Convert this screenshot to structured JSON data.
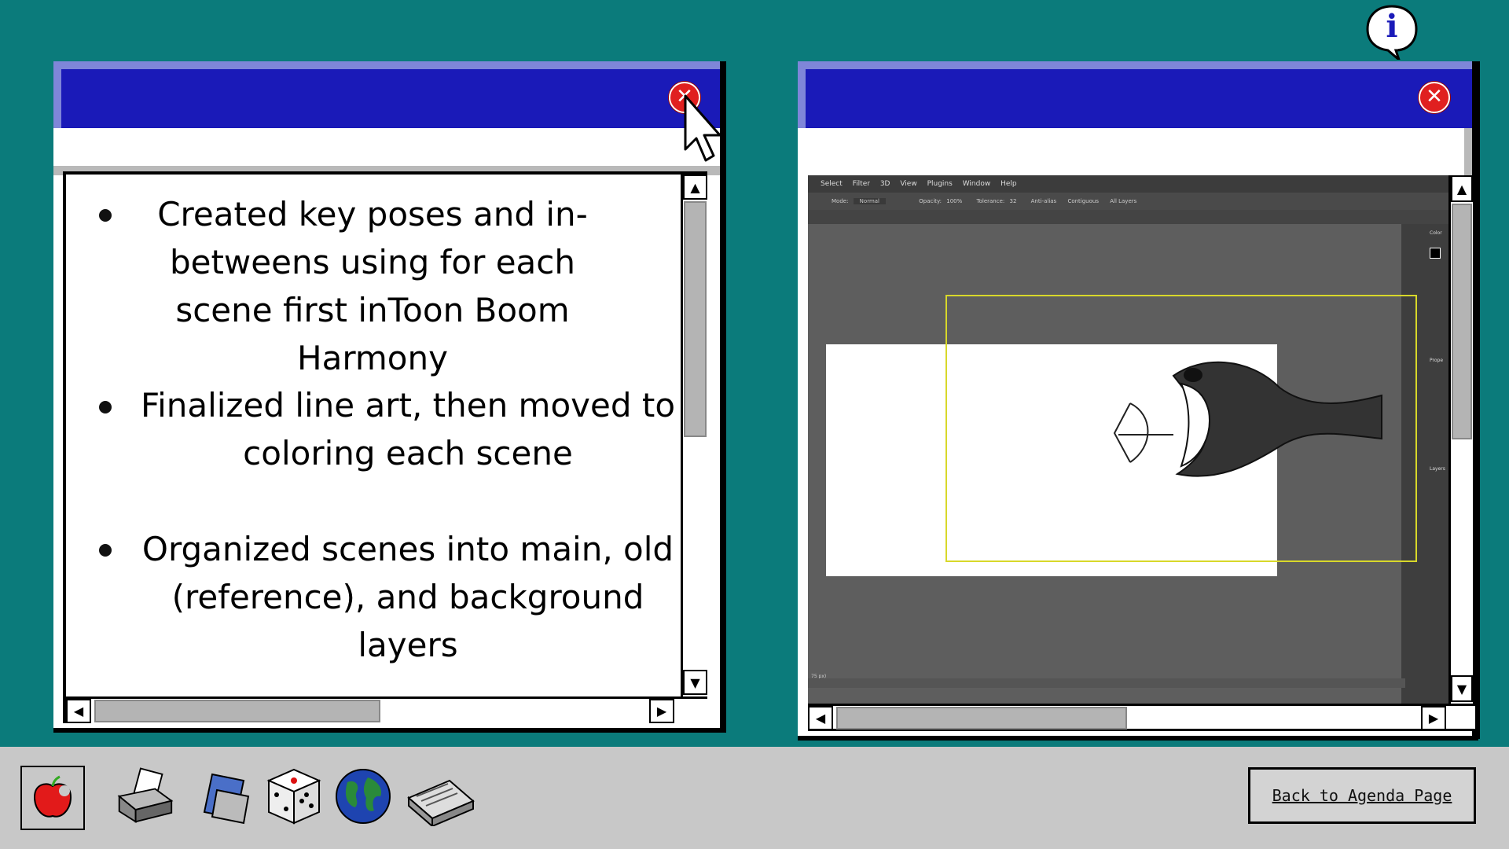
{
  "left_window": {
    "bullets": [
      "Created key poses and in-betweens using for each scene first inToon Boom Harmony",
      "Finalized line art, then moved to coloring each scene",
      "Organized scenes into main, old (reference), and background layers"
    ],
    "close_label": "✕"
  },
  "right_window": {
    "close_label": "✕",
    "screenshot": {
      "menu": [
        "Select",
        "Filter",
        "3D",
        "View",
        "Plugins",
        "Window",
        "Help"
      ],
      "options": [
        "Mode:",
        "Normal",
        "Opacity:",
        "100%",
        "Tolerance:",
        "32",
        "Anti-alias",
        "Contiguous",
        "All Layers"
      ],
      "panels": [
        "Color",
        "Prope",
        "Layers"
      ],
      "zoom_text": "75 px)"
    }
  },
  "taskbar": {
    "icons": [
      "apple-icon",
      "printer-icon",
      "notepad-icon",
      "dice-icon",
      "globe-icon",
      "scanner-icon"
    ],
    "agenda_button": "Back to Agenda Page"
  },
  "info_icon_label": "i",
  "colors": {
    "desktop": "#0b7b7b",
    "titlebar": "#1a1ab8",
    "titlebar_edge": "#7f86d9",
    "close": "#e02020",
    "taskbar": "#c8c8c8"
  }
}
